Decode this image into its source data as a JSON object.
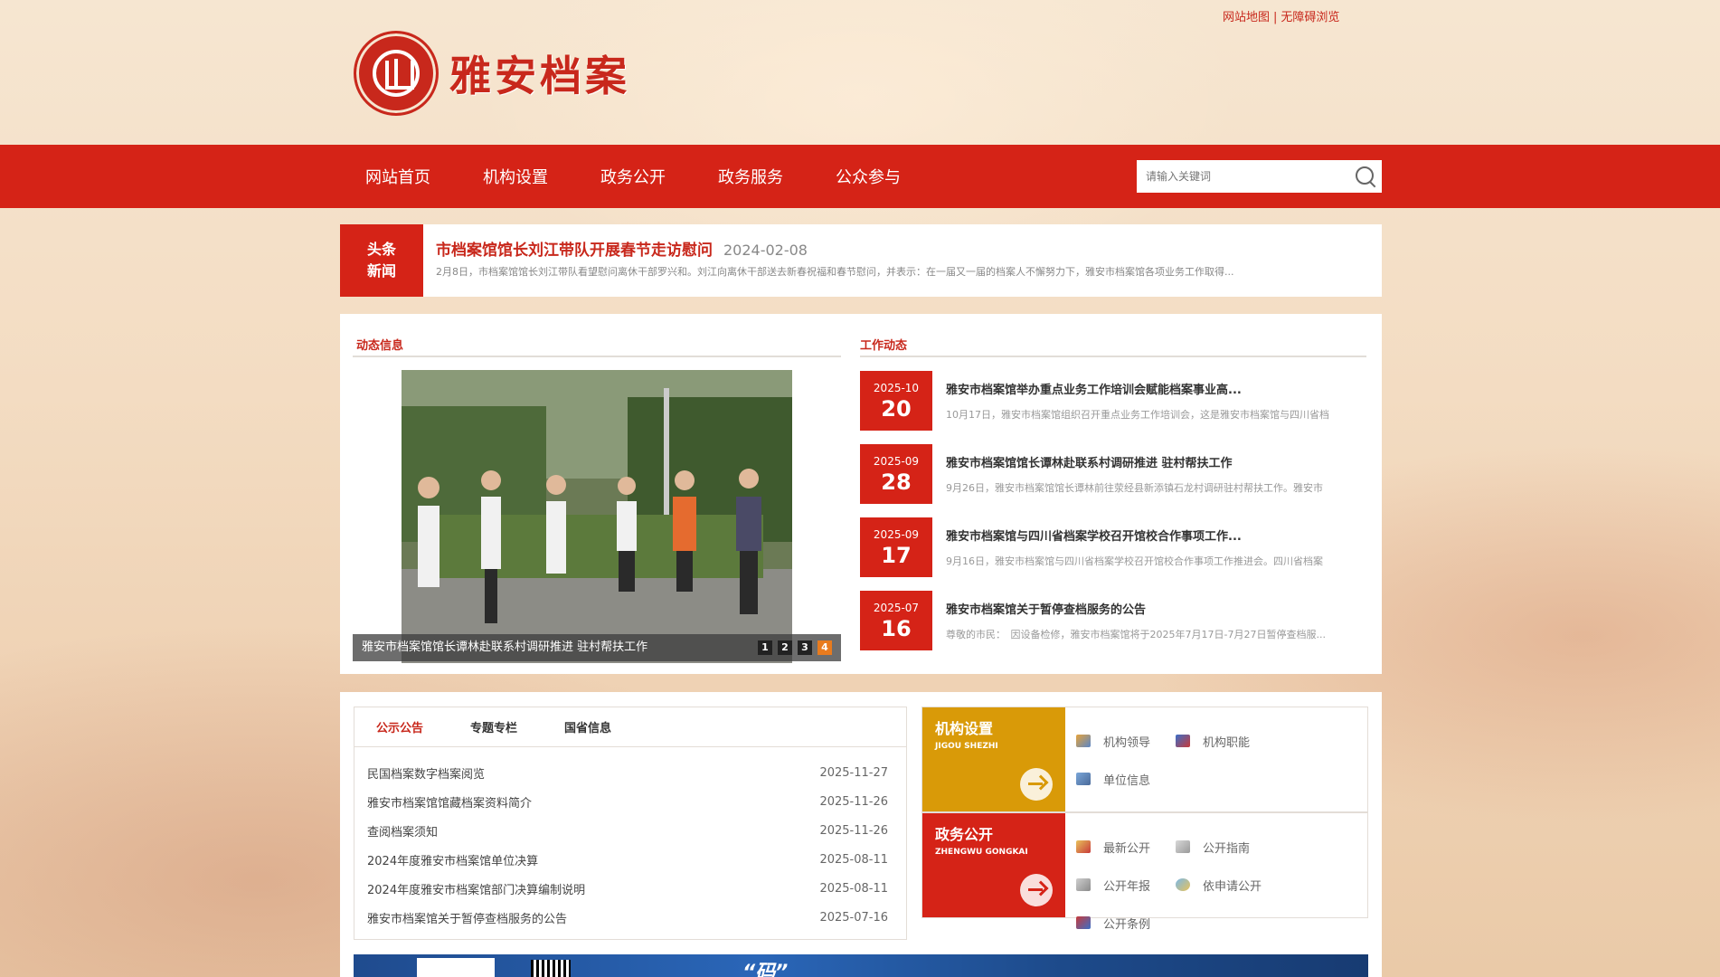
{
  "top_links": {
    "sitemap": "网站地图",
    "separator": "|",
    "accessibility": "无障碍浏览"
  },
  "logo": {
    "title": "雅安档案"
  },
  "nav": {
    "items": [
      "网站首页",
      "机构设置",
      "政务公开",
      "政务服务",
      "公众参与"
    ],
    "search_placeholder": "请输入关键词"
  },
  "headline": {
    "badge_line1": "头条",
    "badge_line2": "新闻",
    "title": "市档案馆馆长刘江带队开展春节走访慰问",
    "date": "2024-02-08",
    "summary": "2月8日，市档案馆馆长刘江带队看望慰问离休干部罗兴和。刘江向离休干部送去新春祝福和春节慰问，并表示：在一届又一届的档案人不懈努力下，雅安市档案馆各项业务工作取得..."
  },
  "dynamic": {
    "title": "动态信息",
    "caption": "雅安市档案馆馆长谭林赴联系村调研推进 驻村帮扶工作",
    "slide_indicators": [
      "1",
      "2",
      "3",
      "4"
    ],
    "active_indicator": 4
  },
  "work": {
    "title": "工作动态",
    "items": [
      {
        "ym": "2025-10",
        "day": "20",
        "title": "雅安市档案馆举办重点业务工作培训会赋能档案事业高...",
        "summary": "10月17日，雅安市档案馆组织召开重点业务工作培训会，这是雅安市档案馆与四川省档"
      },
      {
        "ym": "2025-09",
        "day": "28",
        "title": "雅安市档案馆馆长谭林赴联系村调研推进 驻村帮扶工作",
        "summary": "9月26日，雅安市档案馆馆长谭林前往荥经县新添镇石龙村调研驻村帮扶工作。雅安市"
      },
      {
        "ym": "2025-09",
        "day": "17",
        "title": "雅安市档案馆与四川省档案学校召开馆校合作事项工作...",
        "summary": "9月16日，雅安市档案馆与四川省档案学校召开馆校合作事项工作推进会。四川省档案"
      },
      {
        "ym": "2025-07",
        "day": "16",
        "title": "雅安市档案馆关于暂停查档服务的公告",
        "summary": "尊敬的市民：　因设备检修，雅安市档案馆将于2025年7月17日-7月27日暂停查档服..."
      }
    ]
  },
  "notices": {
    "tabs": [
      "公示公告",
      "专题专栏",
      "国省信息"
    ],
    "active_tab": 0,
    "rows": [
      {
        "title": "民国档案数字档案阅览",
        "date": "2025-11-27"
      },
      {
        "title": "雅安市档案馆馆藏档案资料简介",
        "date": "2025-11-26"
      },
      {
        "title": "查阅档案须知",
        "date": "2025-11-26"
      },
      {
        "title": "2024年度雅安市档案馆单位决算",
        "date": "2025-08-11"
      },
      {
        "title": "2024年度雅安市档案馆部门决算编制说明",
        "date": "2025-08-11"
      },
      {
        "title": "雅安市档案馆关于暂停查档服务的公告",
        "date": "2025-07-16"
      }
    ]
  },
  "org_block": {
    "cn": "机构设置",
    "en": "JIGOU SHEZHI",
    "color": "#d99a08",
    "links": [
      "机构领导",
      "机构职能",
      "单位信息"
    ]
  },
  "gov_block": {
    "cn": "政务公开",
    "en": "ZHENGWU GONGKAI",
    "color": "#d52317",
    "links": [
      "最新公开",
      "公开指南",
      "公开年报",
      "依申请公开",
      "公开条例"
    ]
  },
  "banner": {
    "text": "“码”"
  }
}
